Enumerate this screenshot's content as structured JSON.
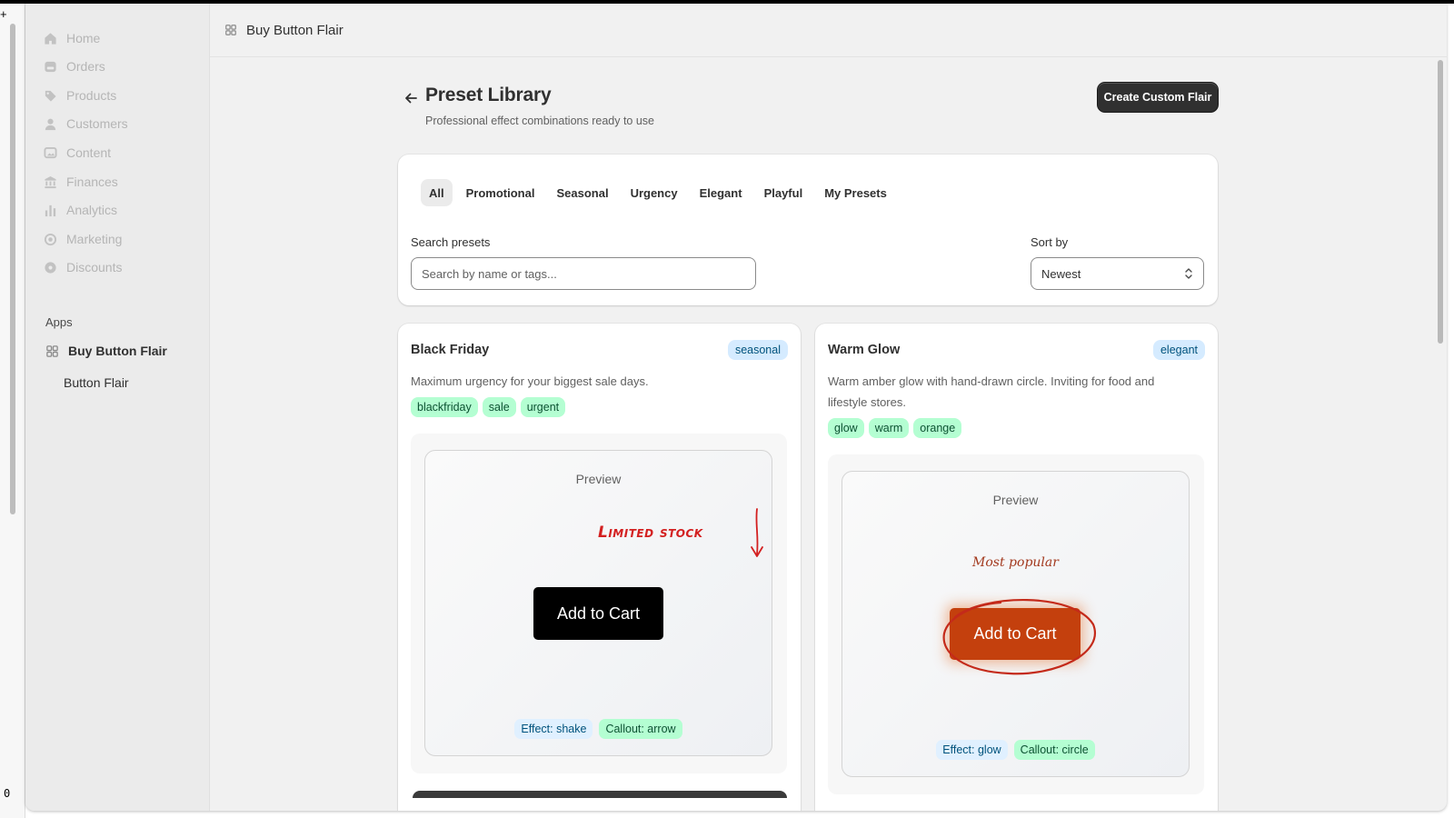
{
  "sidebar": {
    "nav": [
      {
        "label": "Home",
        "icon": "home-icon"
      },
      {
        "label": "Orders",
        "icon": "orders-icon"
      },
      {
        "label": "Products",
        "icon": "tag-icon"
      },
      {
        "label": "Customers",
        "icon": "person-icon"
      },
      {
        "label": "Content",
        "icon": "image-icon"
      },
      {
        "label": "Finances",
        "icon": "bank-icon"
      },
      {
        "label": "Analytics",
        "icon": "bar-chart-icon"
      },
      {
        "label": "Marketing",
        "icon": "target-icon"
      },
      {
        "label": "Discounts",
        "icon": "gear-badge-icon"
      }
    ],
    "apps_title": "Apps",
    "app_item": "Buy Button Flair",
    "app_sub_item": "Button Flair"
  },
  "header": {
    "title": "Buy Button Flair"
  },
  "page": {
    "title": "Preset Library",
    "subtitle": "Professional effect combinations ready to use",
    "create_button": "Create Custom Flair"
  },
  "filters": {
    "tabs": [
      "All",
      "Promotional",
      "Seasonal",
      "Urgency",
      "Elegant",
      "Playful",
      "My Presets"
    ],
    "active_tab": "All",
    "search_label": "Search presets",
    "search_placeholder": "Search by name or tags...",
    "sort_label": "Sort by",
    "sort_value": "Newest"
  },
  "presets": [
    {
      "name": "Black Friday",
      "category": "seasonal",
      "description": "Maximum urgency for your biggest sale days.",
      "tags": [
        "blackfriday",
        "sale",
        "urgent"
      ],
      "preview_label": "Preview",
      "callout_text": "Limited stock",
      "cta_label": "Add to Cart",
      "effect": "Effect: shake",
      "callout": "Callout: arrow"
    },
    {
      "name": "Warm Glow",
      "category": "elegant",
      "description": "Warm amber glow with hand-drawn circle. Inviting for food and lifestyle stores.",
      "tags": [
        "glow",
        "warm",
        "orange"
      ],
      "preview_label": "Preview",
      "callout_text": "Most popular",
      "cta_label": "Add to Cart",
      "effect": "Effect: glow",
      "callout": "Callout: circle"
    }
  ],
  "left_edge": {
    "counter": "0"
  },
  "colors": {
    "primary_button": "#303030",
    "black_friday_cta": "#000000",
    "warm_glow_cta": "#c4400d",
    "callout_red": "#d32020"
  }
}
